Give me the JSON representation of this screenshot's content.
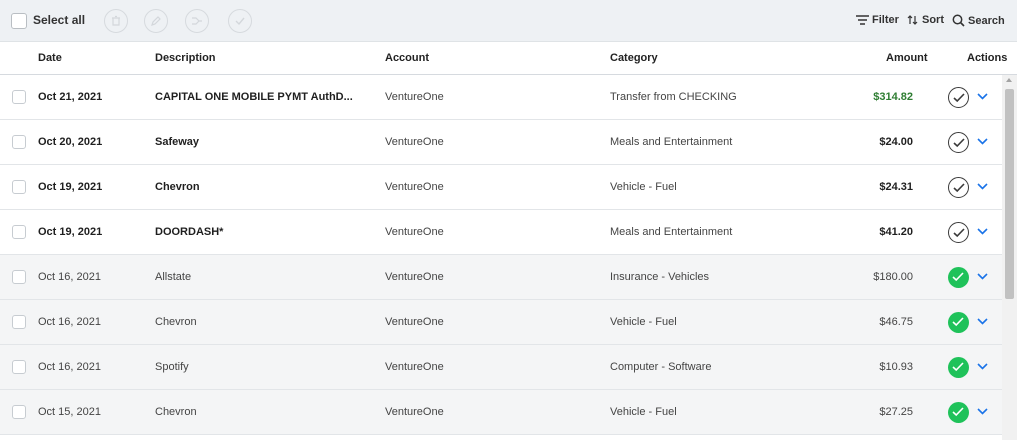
{
  "toolbar": {
    "select_all": "Select all",
    "filter": "Filter",
    "sort": "Sort",
    "search": "Search"
  },
  "columns": {
    "date": "Date",
    "description": "Description",
    "account": "Account",
    "category": "Category",
    "amount": "Amount",
    "actions": "Actions"
  },
  "colors": {
    "positive_amount": "#2e7d32",
    "reviewed_check": "#1fc25a",
    "chevron": "#1a73e8"
  },
  "rows": [
    {
      "date": "Oct 21, 2021",
      "description": "CAPITAL ONE MOBILE PYMT AuthD...",
      "account": "VentureOne",
      "category": "Transfer from CHECKING",
      "amount": "$314.82",
      "status": "pending"
    },
    {
      "date": "Oct 20, 2021",
      "description": "Safeway",
      "account": "VentureOne",
      "category": "Meals and Entertainment",
      "amount": "$24.00",
      "status": "pending"
    },
    {
      "date": "Oct 19, 2021",
      "description": "Chevron",
      "account": "VentureOne",
      "category": "Vehicle - Fuel",
      "amount": "$24.31",
      "status": "pending"
    },
    {
      "date": "Oct 19, 2021",
      "description": "DOORDASH*",
      "account": "VentureOne",
      "category": "Meals and Entertainment",
      "amount": "$41.20",
      "status": "pending"
    },
    {
      "date": "Oct 16, 2021",
      "description": "Allstate",
      "account": "VentureOne",
      "category": "Insurance - Vehicles",
      "amount": "$180.00",
      "status": "reviewed"
    },
    {
      "date": "Oct 16, 2021",
      "description": "Chevron",
      "account": "VentureOne",
      "category": "Vehicle - Fuel",
      "amount": "$46.75",
      "status": "reviewed"
    },
    {
      "date": "Oct 16, 2021",
      "description": "Spotify",
      "account": "VentureOne",
      "category": "Computer - Software",
      "amount": "$10.93",
      "status": "reviewed"
    },
    {
      "date": "Oct 15, 2021",
      "description": "Chevron",
      "account": "VentureOne",
      "category": "Vehicle - Fuel",
      "amount": "$27.25",
      "status": "reviewed"
    }
  ]
}
